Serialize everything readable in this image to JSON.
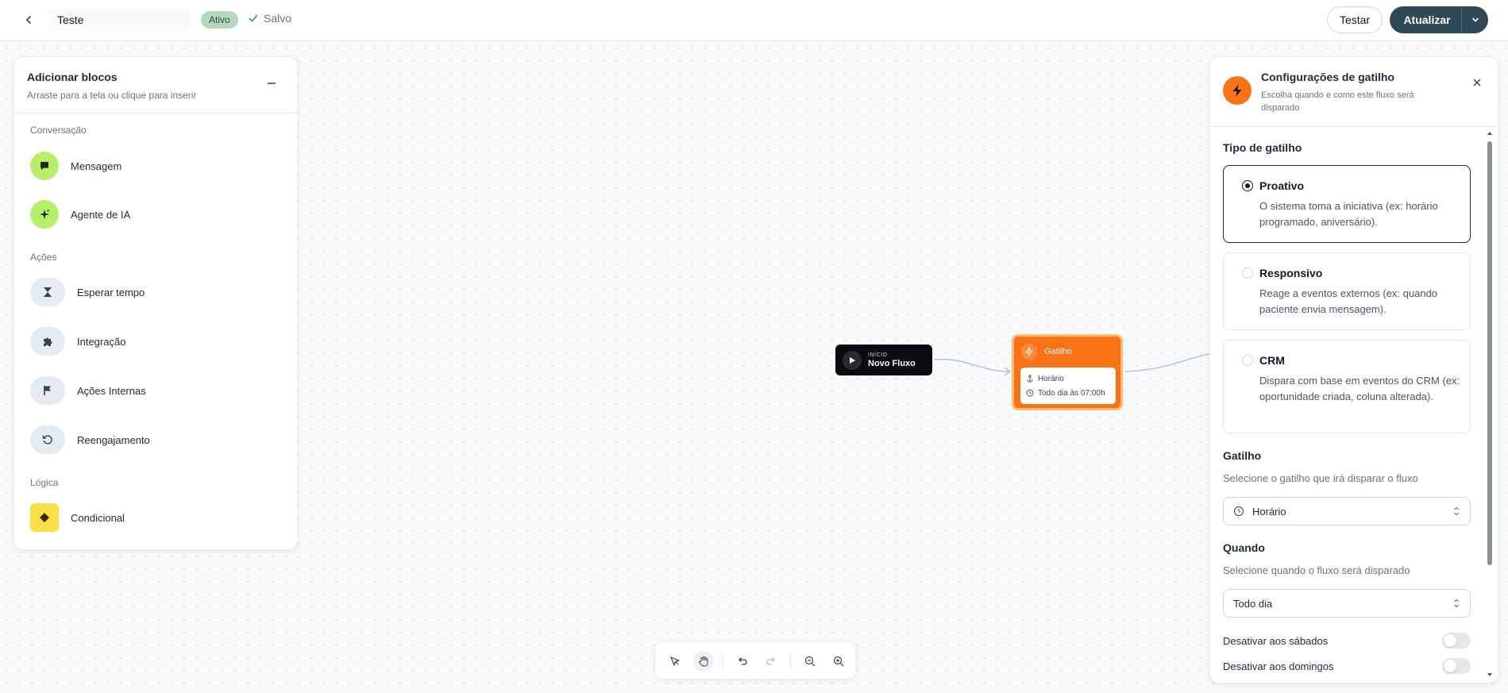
{
  "header": {
    "flow_name": "Teste",
    "status": "Ativo",
    "saved": "Salvo",
    "test_label": "Testar",
    "update_label": "Atualizar"
  },
  "blocks_panel": {
    "title": "Adicionar blocos",
    "subtitle": "Arraste para a tela ou clique para inserir",
    "sections": [
      {
        "label": "Conversação",
        "items": [
          {
            "label": "Mensagem",
            "icon": "chat-icon"
          },
          {
            "label": "Agente de IA",
            "icon": "sparkle-icon"
          }
        ]
      },
      {
        "label": "Ações",
        "items": [
          {
            "label": "Esperar tempo",
            "icon": "hourglass-icon"
          },
          {
            "label": "Integração",
            "icon": "puzzle-icon"
          },
          {
            "label": "Ações Internas",
            "icon": "flag-icon"
          },
          {
            "label": "Reengajamento",
            "icon": "refresh-icon"
          }
        ]
      },
      {
        "label": "Lógica",
        "items": [
          {
            "label": "Condicional",
            "icon": "diamond-icon"
          }
        ]
      }
    ]
  },
  "nodes": {
    "start": {
      "small": "INÍCIO",
      "name": "Novo Fluxo"
    },
    "trigger": {
      "title": "Gatilho",
      "line1": "Horário",
      "line2": "Todo dia às 07:00h"
    }
  },
  "config": {
    "title": "Configurações de gatilho",
    "subtitle": "Escolha quando e como este fluxo será disparado",
    "type_label": "Tipo de gatilho",
    "options": [
      {
        "title": "Proativo",
        "desc": "O sistema toma a iniciativa (ex: horário programado, aniversário).",
        "selected": true
      },
      {
        "title": "Responsivo",
        "desc": "Reage a eventos externos (ex: quando paciente envia mensagem).",
        "selected": false
      },
      {
        "title": "CRM",
        "desc": "Dispara com base em eventos do CRM (ex: oportunidade criada, coluna alterada).",
        "selected": false
      }
    ],
    "trigger_label": "Gatilho",
    "trigger_help": "Selecione o gatilho que irá disparar o fluxo",
    "trigger_value": "Horário",
    "when_label": "Quando",
    "when_help": "Selecione quando o fluxo será disparado",
    "when_value": "Todo dia",
    "toggle_saturday": "Desativar aos sábados",
    "toggle_sunday": "Desativar aos domingos"
  },
  "colors": {
    "accent_orange": "#f97316",
    "primary_dark": "#2f4a55",
    "green_badge": "#b7d6bd",
    "lime": "#b6f067"
  }
}
